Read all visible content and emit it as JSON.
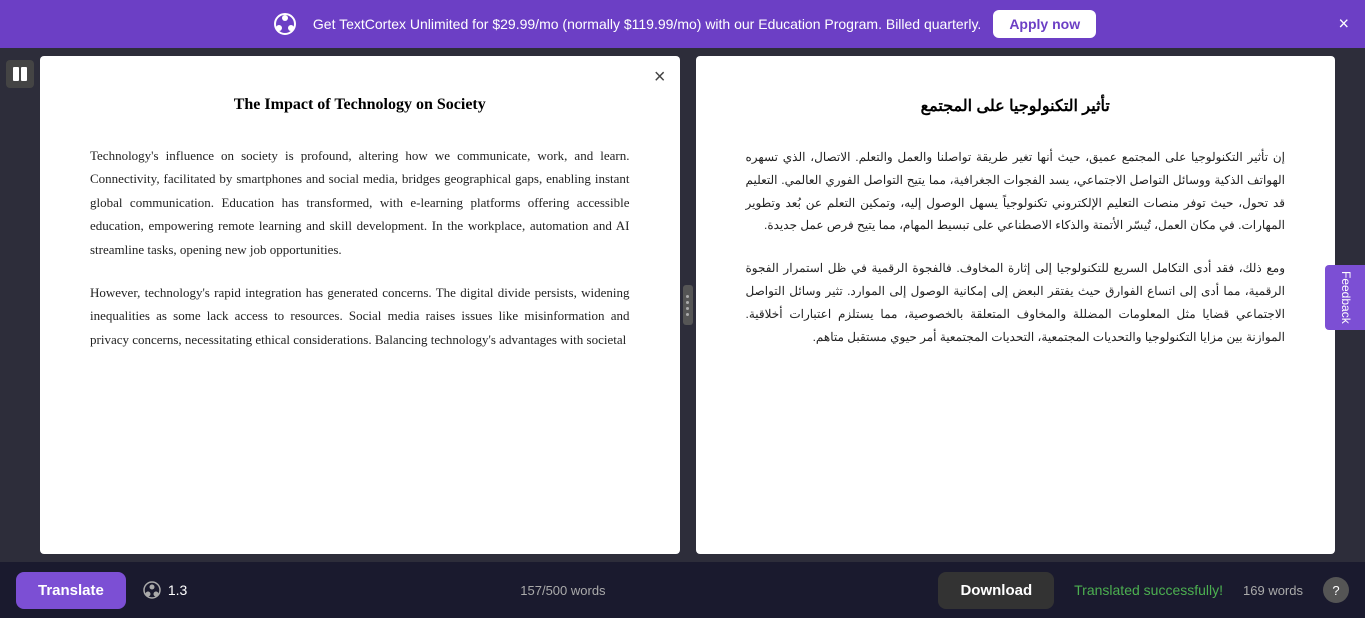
{
  "banner": {
    "text": "Get TextCortex Unlimited for $29.99/mo (normally $119.99/mo) with our Education Program. Billed quarterly.",
    "apply_label": "Apply now",
    "close_label": "×"
  },
  "source_panel": {
    "title": "The Impact of Technology on Society",
    "close_label": "×",
    "paragraph1": "Technology's influence on society is profound, altering how we communicate, work, and learn. Connectivity, facilitated by smartphones and social media, bridges geographical gaps, enabling instant global communication. Education has transformed, with e-learning platforms offering accessible education, empowering remote learning and skill development. In the workplace, automation and AI streamline tasks, opening new job opportunities.",
    "paragraph2": "However, technology's rapid integration has generated concerns. The digital divide persists, widening inequalities as some lack access to resources. Social media raises issues like misinformation and privacy concerns, necessitating ethical considerations. Balancing technology's advantages with societal"
  },
  "target_panel": {
    "title": "تأثير التكنولوجيا على المجتمع",
    "paragraph1": "إن تأثير التكنولوجيا على المجتمع عميق، حيث أنها تغير طريقة تواصلنا والعمل والتعلم. الاتصال، الذي تسهره الهواتف الذكية ووسائل التواصل الاجتماعي، يسد الفجوات الجغرافية، مما يتيح التواصل الفوري العالمي. التعليم قد تحول، حيث توفر منصات التعليم الإلكتروني تكنولوجياً يسهل الوصول إليه، وتمكين التعلم عن بُعد وتطوير المهارات. في مكان العمل، تُيسّر الأتمتة والذكاء الاصطناعي على تبسيط المهام، مما يتيح فرص عمل جديدة.",
    "paragraph2": "ومع ذلك، فقد أدى التكامل السريع للتكنولوجيا إلى إثارة المخاوف. فالفجوة الرقمية في ظل استمرار الفجوة الرقمية، مما أدى إلى اتساع الفوارق حيث يفتقر البعض إلى إمكانية الوصول إلى الموارد. تثير وسائل التواصل الاجتماعي قضايا مثل المعلومات المضللة والمخاوف المتعلقة بالخصوصية، مما يستلزم اعتبارات أخلاقية. الموازنة بين مزايا التكنولوجيا والتحديات المجتمعية، التحديات المجتمعية أمر حيوي مستقبل متاهم."
  },
  "toolbar": {
    "translate_label": "Translate",
    "token_count": "1.3",
    "word_count": "157/500 words",
    "download_label": "Download",
    "success_text": "Translated successfully!",
    "word_count_right": "169 words",
    "help_label": "?"
  },
  "feedback": {
    "label": "Feedback"
  }
}
